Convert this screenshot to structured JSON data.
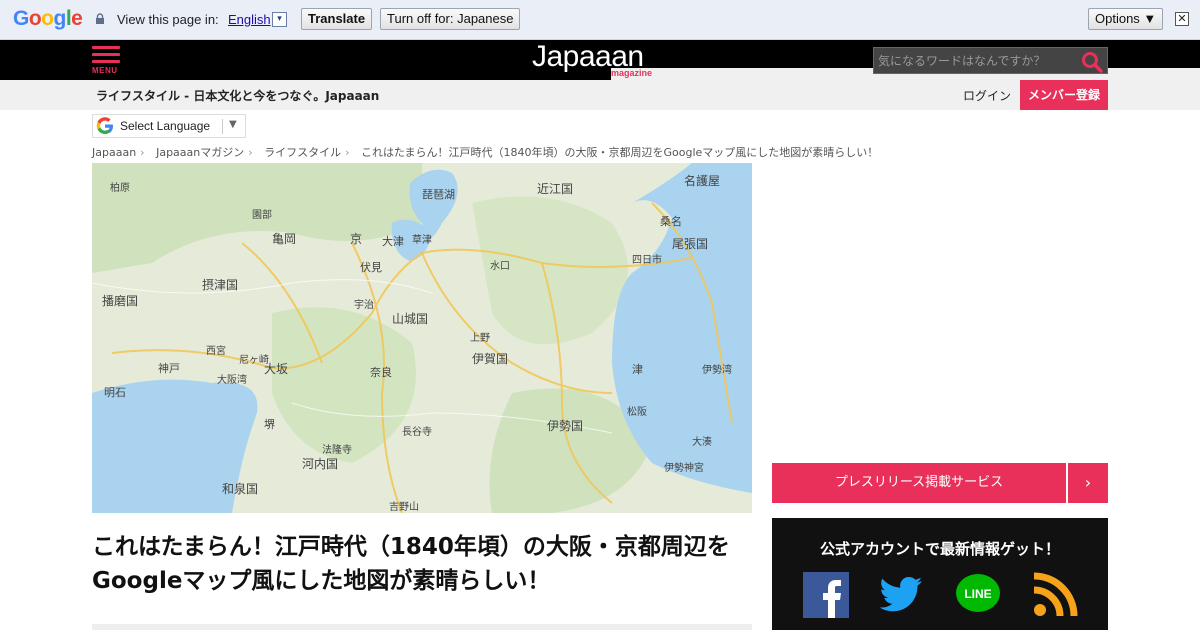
{
  "translate_bar": {
    "logo_letters": [
      "G",
      "o",
      "o",
      "g",
      "l",
      "e"
    ],
    "view_text": "View this page in:",
    "language": "English",
    "dropdown_glyph": "▾",
    "translate_label": "Translate",
    "turn_off_label": "Turn off for: Japanese",
    "options_label": "Options ▼",
    "close_glyph": "✕"
  },
  "header": {
    "menu_label": "MENU",
    "logo_text": "Japaaan",
    "logo_sub": "magazine",
    "search_placeholder": "気になるワードはなんですか？"
  },
  "subheader": {
    "tagline": "ライフスタイル - 日本文化と今をつなぐ。Japaaan",
    "login": "ログイン",
    "register": "メンバー登録"
  },
  "language_selector": {
    "label": "Select Language",
    "arrow": "▼"
  },
  "breadcrumb": [
    "Japaaan",
    "Japaaanマガジン",
    "ライフスタイル",
    "これはたまらん！江戸時代（1840年頃）の大阪・京都周辺をGoogleマップ風にした地図が素晴らしい！"
  ],
  "breadcrumb_sep": "›",
  "map_labels": [
    {
      "t": "柏原"
    },
    {
      "t": "亀岡"
    },
    {
      "t": "園部"
    },
    {
      "t": "山城国"
    },
    {
      "t": "京"
    },
    {
      "t": "大津"
    },
    {
      "t": "近江国"
    },
    {
      "t": "名護屋"
    },
    {
      "t": "尾張国"
    },
    {
      "t": "摂津国"
    },
    {
      "t": "播磨国"
    },
    {
      "t": "伏見"
    },
    {
      "t": "大坂"
    },
    {
      "t": "堺"
    },
    {
      "t": "奈良"
    },
    {
      "t": "伊賀国"
    },
    {
      "t": "伊勢国"
    },
    {
      "t": "津"
    },
    {
      "t": "桑名"
    },
    {
      "t": "四日市"
    },
    {
      "t": "河内国"
    },
    {
      "t": "和泉国"
    },
    {
      "t": "明石"
    },
    {
      "t": "神戸"
    },
    {
      "t": "西宮"
    },
    {
      "t": "尼ヶ崎"
    },
    {
      "t": "宇治"
    },
    {
      "t": "草津"
    },
    {
      "t": "水口"
    },
    {
      "t": "上野"
    },
    {
      "t": "松阪"
    },
    {
      "t": "大湊"
    },
    {
      "t": "伊勢神宮"
    },
    {
      "t": "琵琶湖"
    },
    {
      "t": "伊勢湾"
    },
    {
      "t": "大阪湾"
    },
    {
      "t": "吉野山"
    },
    {
      "t": "長谷寺"
    },
    {
      "t": "法隆寺"
    }
  ],
  "article": {
    "title": "これはたまらん！江戸時代（1840年頃）の大阪・京都周辺をGoogleマップ風にした地図が素晴らしい！"
  },
  "sidebar": {
    "press_label": "プレスリリース掲載サービス",
    "press_chevron": "›",
    "social_heading": "公式アカウントで最新情報ゲット！",
    "social": [
      {
        "name": "facebook",
        "color": "#3b5998"
      },
      {
        "name": "twitter",
        "color": "#1da1f2"
      },
      {
        "name": "line",
        "color": "#00b900"
      },
      {
        "name": "rss",
        "color": "#f7a21b"
      }
    ]
  },
  "colors": {
    "accent": "#e8305a",
    "header_bg": "#000000",
    "map_land": "#e6ebd9",
    "map_water": "#a9d3ee"
  }
}
